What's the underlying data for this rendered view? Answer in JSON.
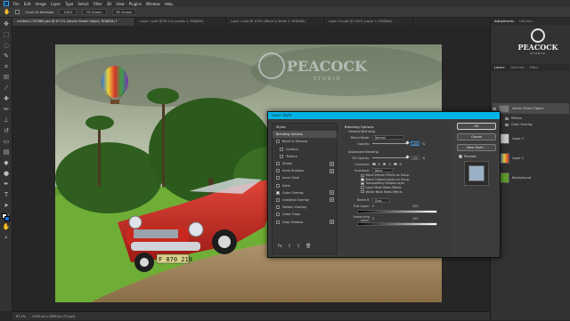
{
  "app": {
    "logo": "Ps",
    "menu": [
      "File",
      "Edit",
      "Image",
      "Layer",
      "Type",
      "Select",
      "Filter",
      "3D",
      "View",
      "Plugins",
      "Window",
      "Help"
    ]
  },
  "options": {
    "scroll_all": "Scroll All Windows",
    "zoom_level": "100%",
    "fit_screen": "Fit Screen",
    "fill_screen": "Fill Screen"
  },
  "tabs": [
    {
      "label": "untitled-1197860.psd @ 67.2% (Vector Smart Object, RGB/8#) *",
      "active": true
    },
    {
      "label": "Layer 1.psb @ 85.1% (Levels 1, RGB/8#)",
      "active": false
    },
    {
      "label": "Layer 1.psb @ 100% (Black & White 1, RGB/8#)",
      "active": false
    },
    {
      "label": "Layer 23.psb @ 100% (Layer 2, RGB/8#)",
      "active": false
    }
  ],
  "status": {
    "zoom": "67.2%",
    "doc": "1920 px x 1080 px (72 ppi)"
  },
  "artwork": {
    "watermark": "PEACOCK",
    "watermark_sub": "STUDIO",
    "plate": "F 070 219"
  },
  "panels": {
    "top_tabs": [
      "Adjustments",
      "Libraries"
    ],
    "watermark": "PEACOCK",
    "watermark_sub": "STUDIO",
    "layers_tabs": [
      "Layers",
      "Channels",
      "Paths"
    ],
    "layers": [
      {
        "name": "Vector Smart Object",
        "sub": ""
      },
      {
        "name": "Effects",
        "sub": ""
      },
      {
        "name": "Color Overlay",
        "sub": ""
      },
      {
        "name": "Layer 1",
        "sub": ""
      },
      {
        "name": "Layer 2",
        "sub": ""
      },
      {
        "name": "Background",
        "sub": ""
      }
    ]
  },
  "dialog": {
    "title": "Layer Style",
    "styles": [
      {
        "label": "Styles",
        "head": true,
        "checkbox": false,
        "plus": false
      },
      {
        "label": "Blending Options",
        "head": true,
        "checkbox": false,
        "plus": false,
        "selected": true
      },
      {
        "label": "Bevel & Emboss",
        "checkbox": true,
        "plus": false
      },
      {
        "label": "Contour",
        "checkbox": true,
        "plus": false
      },
      {
        "label": "Texture",
        "checkbox": true,
        "plus": false
      },
      {
        "label": "Stroke",
        "checkbox": true,
        "plus": true
      },
      {
        "label": "Inner Shadow",
        "checkbox": true,
        "plus": true
      },
      {
        "label": "Inner Glow",
        "checkbox": true,
        "plus": false
      },
      {
        "label": "Satin",
        "checkbox": true,
        "plus": false
      },
      {
        "label": "Color Overlay",
        "checkbox": true,
        "plus": true
      },
      {
        "label": "Gradient Overlay",
        "checkbox": true,
        "plus": true
      },
      {
        "label": "Pattern Overlay",
        "checkbox": true,
        "plus": false
      },
      {
        "label": "Outer Glow",
        "checkbox": true,
        "plus": false
      },
      {
        "label": "Drop Shadow",
        "checkbox": true,
        "plus": true
      }
    ],
    "blending": {
      "title": "Blending Options",
      "general": "General Blending",
      "blend_mode_label": "Blend Mode:",
      "blend_mode": "Normal",
      "opacity_label": "Opacity:",
      "opacity": "100",
      "advanced": "Advanced Blending",
      "fill_label": "Fill Opacity:",
      "fill": "100",
      "channels_label": "Channels:",
      "channels": [
        "R",
        "G",
        "B"
      ],
      "knockout_label": "Knockout:",
      "knockout": "None",
      "options": [
        {
          "label": "Blend Interior Effects as Group",
          "on": false
        },
        {
          "label": "Blend Clipped Layers as Group",
          "on": true
        },
        {
          "label": "Transparency Shapes Layer",
          "on": true
        },
        {
          "label": "Layer Mask Hides Effects",
          "on": false
        },
        {
          "label": "Vector Mask Hides Effects",
          "on": false
        }
      ],
      "blend_if_label": "Blend If:",
      "blend_if": "Gray",
      "this_layer_label": "This Layer:",
      "this_layer_min": "0",
      "this_layer_max": "255",
      "underlying_label": "Underlying Layer:",
      "underlying_min": "0",
      "underlying_max": "255",
      "percent": "%"
    },
    "buttons": {
      "ok": "OK",
      "cancel": "Cancel",
      "new_style": "New Style...",
      "preview": "Preview"
    },
    "footer": [
      "fx",
      "⇧",
      "⇩",
      "🗑"
    ]
  },
  "colors": {
    "accent": "#00b3e6",
    "ps_blue": "#31a8ff",
    "car_red": "#c8281f",
    "sky": "#b8c4a8"
  }
}
